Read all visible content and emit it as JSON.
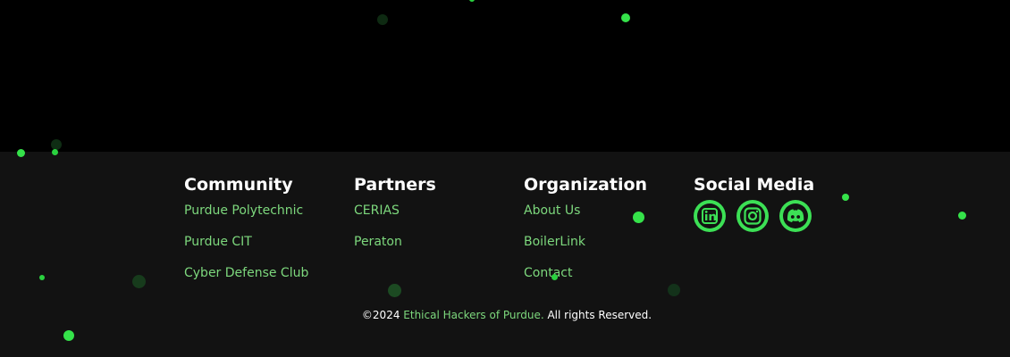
{
  "footer": {
    "columns": [
      {
        "title": "Community",
        "links": [
          "Purdue Polytechnic",
          "Purdue CIT",
          "Cyber Defense Club"
        ]
      },
      {
        "title": "Partners",
        "links": [
          "CERIAS",
          "Peraton"
        ]
      },
      {
        "title": "Organization",
        "links": [
          "About Us",
          "BoilerLink",
          "Contact"
        ]
      },
      {
        "title": "Social Media"
      }
    ],
    "social_icons": [
      "linkedin-icon",
      "instagram-icon",
      "discord-icon"
    ],
    "copyright": {
      "prefix": "©2024 ",
      "org": "Ethical Hackers of Purdue.",
      "suffix": " All rights Reserved."
    }
  },
  "colors": {
    "accent": "#3ce055",
    "link": "#7dd87d",
    "footer_bg": "#121212",
    "page_bg": "#000000"
  }
}
